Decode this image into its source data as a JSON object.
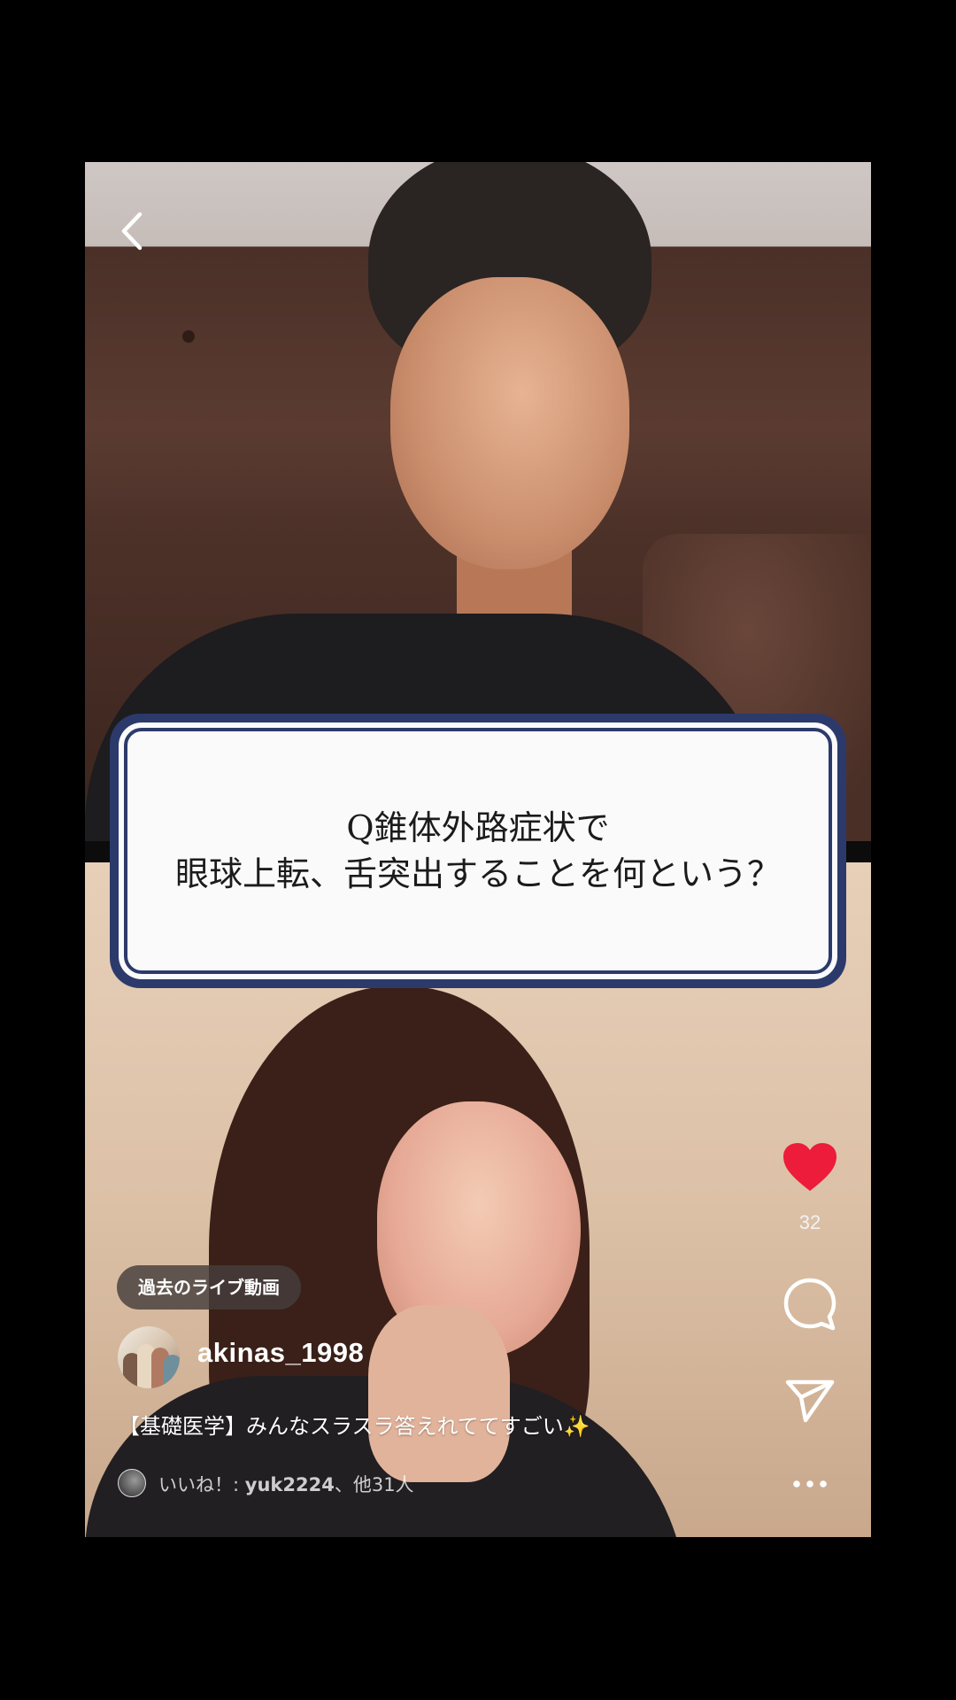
{
  "question": {
    "line1": "Q錐体外路症状で",
    "line2": "眼球上転、舌突出することを何という？"
  },
  "actions": {
    "like_count": "32"
  },
  "post": {
    "chip_label": "過去のライブ動画",
    "username": "akinas_1998",
    "caption": "【基礎医学】みんなスラスラ答えれててすごい✨",
    "likes_prefix": "いいね！: ",
    "likes_user": "yuk2224",
    "likes_suffix": "、他31人"
  },
  "icons": {
    "back": "chevron-left-icon",
    "like": "heart-icon",
    "comment": "comment-bubble-icon",
    "share": "paper-plane-icon",
    "more": "more-horizontal-icon"
  },
  "colors": {
    "like": "#ED1C3B",
    "card_border": "#2C3A6B",
    "background": "#000000"
  }
}
